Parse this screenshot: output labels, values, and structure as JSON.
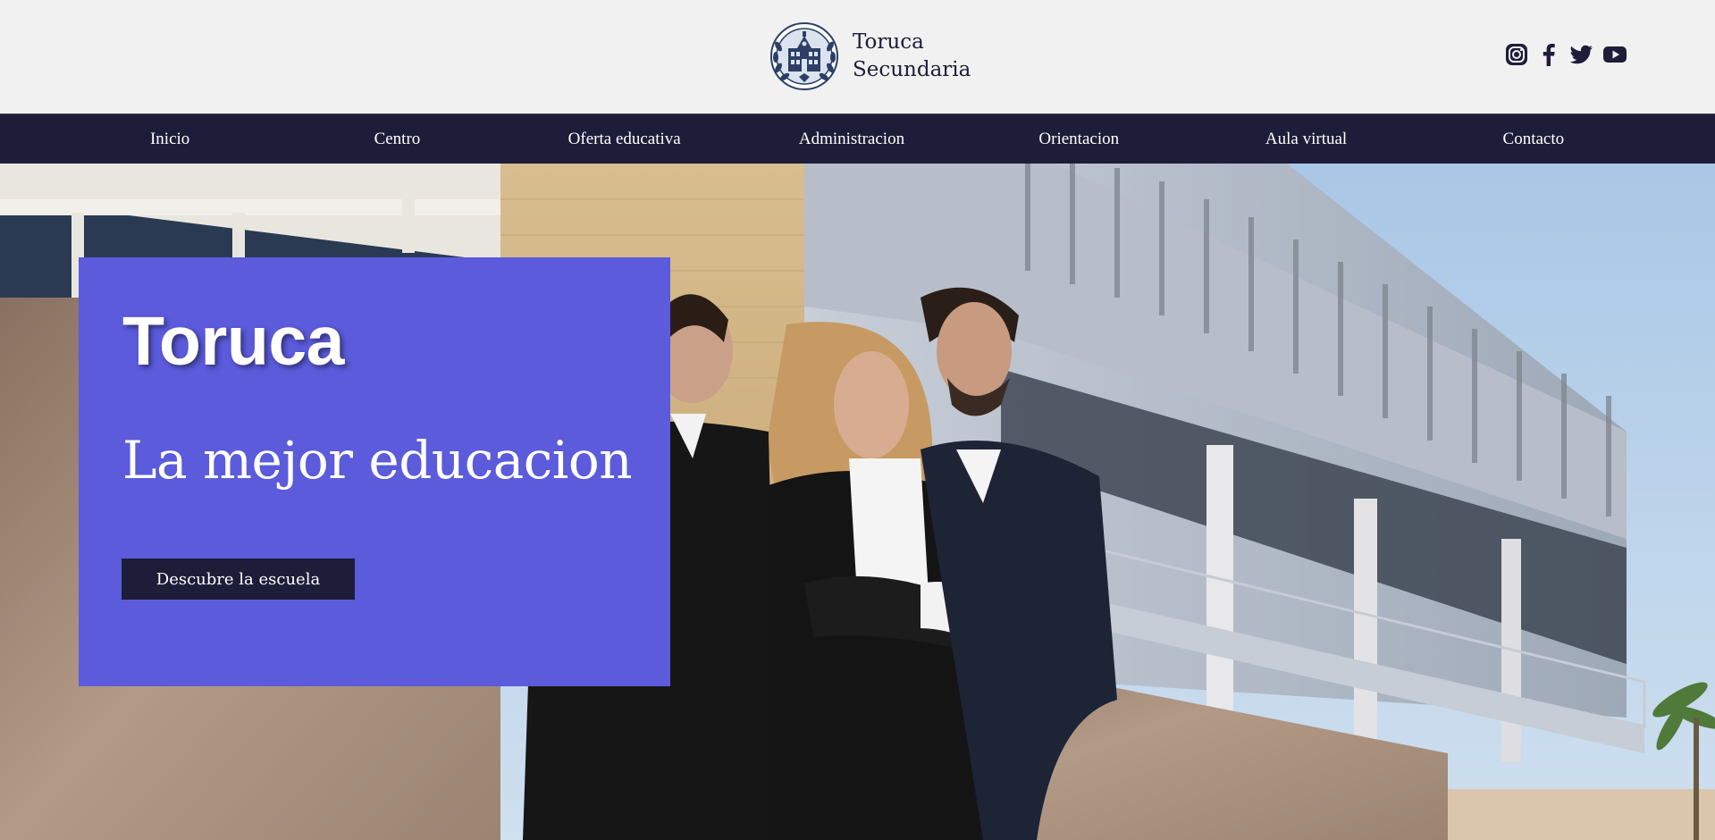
{
  "brand": {
    "name_line1": "Toruca",
    "name_line2": "Secundaria",
    "logo_icon": "school-crest-logo"
  },
  "social": [
    {
      "name": "instagram-icon"
    },
    {
      "name": "facebook-icon"
    },
    {
      "name": "twitter-icon"
    },
    {
      "name": "youtube-icon"
    }
  ],
  "nav": {
    "items": [
      {
        "label": "Inicio"
      },
      {
        "label": "Centro"
      },
      {
        "label": "Oferta educativa"
      },
      {
        "label": "Administracion"
      },
      {
        "label": "Orientacion"
      },
      {
        "label": "Aula virtual"
      },
      {
        "label": "Contacto"
      }
    ]
  },
  "hero": {
    "title": "Toruca",
    "subtitle": "La mejor educacion",
    "button_label": "Descubre la escuela",
    "card_color": "#5b5bdc"
  },
  "colors": {
    "navy": "#1e1d39",
    "accent": "#5b5bdc",
    "header_bg": "#f1f1f1"
  }
}
